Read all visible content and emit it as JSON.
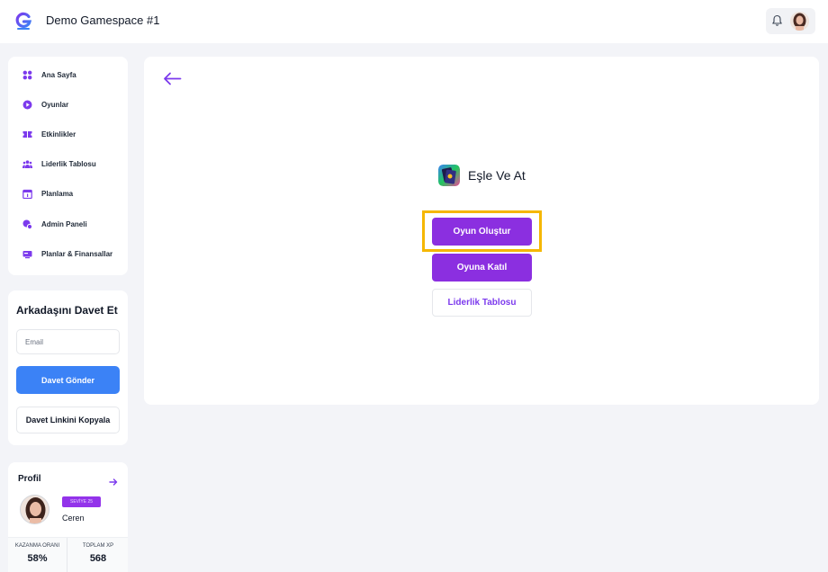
{
  "header": {
    "app_title": "Demo Gamespace #1",
    "logo_icon": "g-logo-icon",
    "notification_icon": "bell-icon"
  },
  "sidebar": {
    "items": [
      {
        "label": "Ana Sayfa",
        "icon": "grid-icon"
      },
      {
        "label": "Oyunlar",
        "icon": "play-circle-icon"
      },
      {
        "label": "Etkinlikler",
        "icon": "ticket-icon"
      },
      {
        "label": "Liderlik Tablosu",
        "icon": "users-icon"
      },
      {
        "label": "Planlama",
        "icon": "calendar-icon"
      },
      {
        "label": "Admin Paneli",
        "icon": "admin-icon"
      },
      {
        "label": "Planlar & Finansallar",
        "icon": "card-icon"
      }
    ]
  },
  "invite": {
    "title": "Arkadaşını Davet Et",
    "email_placeholder": "Email",
    "email_value": "",
    "send_label": "Davet Gönder",
    "copy_label": "Davet Linkini Kopyala"
  },
  "profile": {
    "title": "Profil",
    "level": "SEVİYE 25",
    "name": "Ceren",
    "win_rate_label": "KAZANMA ORANI",
    "win_rate": "58%",
    "total_xp_label": "TOPLAM XP",
    "total_xp": "568"
  },
  "main": {
    "game_name": "Eşle Ve At",
    "create_label": "Oyun Oluştur",
    "join_label": "Oyuna Katıl",
    "leaderboard_label": "Liderlik Tablosu"
  },
  "colors": {
    "accent": "#8b2fe0",
    "blue": "#3b82f6",
    "highlight": "#f5b700"
  }
}
